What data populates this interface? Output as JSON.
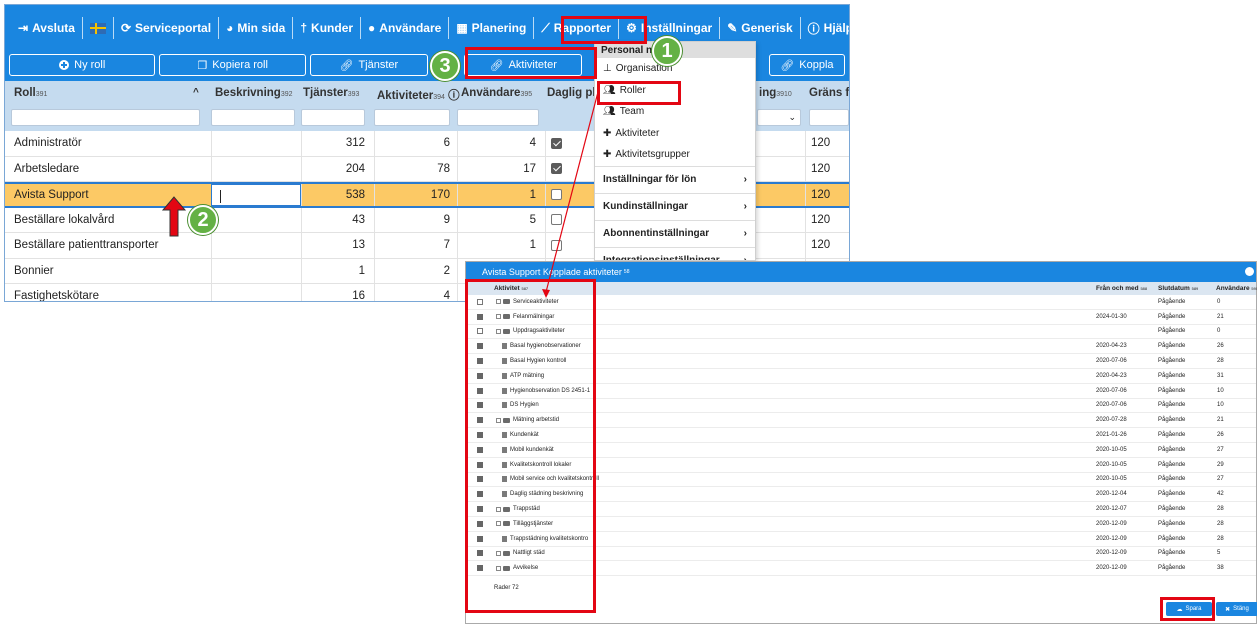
{
  "nav": {
    "items": [
      {
        "icon": "logout-icon",
        "glyph": "⇥",
        "label": "Avsluta"
      },
      {
        "icon": "swedish-flag-icon",
        "glyph": "",
        "label": ""
      },
      {
        "icon": "sync-icon",
        "glyph": "⟳",
        "label": "Serviceportal"
      },
      {
        "icon": "dashboard-icon",
        "glyph": "◕",
        "label": "Min sida"
      },
      {
        "icon": "user-tie-icon",
        "glyph": "†",
        "label": "Kunder"
      },
      {
        "icon": "user-icon",
        "glyph": "●",
        "label": "Användare"
      },
      {
        "icon": "calendar-icon",
        "glyph": "▦",
        "label": "Planering"
      },
      {
        "icon": "line-chart-icon",
        "glyph": "⟋",
        "label": "Rapporter"
      },
      {
        "icon": "cogs-icon",
        "glyph": "⚙",
        "label": "Inställningar"
      },
      {
        "icon": "wrench-icon",
        "glyph": "✎",
        "label": "Generisk"
      },
      {
        "icon": "info-icon",
        "glyph": "ⓘ",
        "label": "Hjälp/Support"
      }
    ]
  },
  "toolbar": {
    "new_role": "Ny roll",
    "copy_role": "Kopiera roll",
    "services": "Tjänster",
    "activities": "Aktiviteter",
    "linked": "Koppla"
  },
  "grid": {
    "headers": {
      "role": "Roll",
      "role_id": "391",
      "description": "Beskrivning",
      "description_id": "392",
      "services": "Tjänster",
      "services_id": "393",
      "activities": "Aktiviteter",
      "activities_id": "394",
      "users": "Användare",
      "users_id": "395",
      "daily": "Daglig pla",
      "hidden_col": "ing",
      "hidden_col_id": "3910",
      "limit": "Gräns fö"
    },
    "rows": [
      {
        "role": "Administratör",
        "services": "312",
        "activities": "6",
        "users": "4",
        "daily": true,
        "limit": "120"
      },
      {
        "role": "Arbetsledare",
        "services": "204",
        "activities": "78",
        "users": "17",
        "daily": true,
        "limit": "120"
      },
      {
        "role": "Avista Support",
        "services": "538",
        "activities": "170",
        "users": "1",
        "daily": false,
        "limit": "120"
      },
      {
        "role": "Beställare lokalvård",
        "services": "43",
        "activities": "9",
        "users": "5",
        "daily": false,
        "limit": "120"
      },
      {
        "role": "Beställare patienttransporter",
        "services": "13",
        "activities": "7",
        "users": "1",
        "daily": false,
        "limit": "120"
      },
      {
        "role": "Bonnier",
        "services": "1",
        "activities": "2",
        "users": "",
        "daily": null,
        "limit": ""
      },
      {
        "role": "Fastighetskötare",
        "services": "16",
        "activities": "4",
        "users": "",
        "daily": null,
        "limit": ""
      }
    ]
  },
  "menu": {
    "header": "Personal        ngar",
    "items": [
      {
        "icon": "sitemap-icon",
        "label": "Organisation"
      },
      {
        "icon": "users-icon",
        "label": "Roller"
      },
      {
        "icon": "users-icon",
        "label": "Team"
      },
      {
        "icon": "puzzle-icon",
        "label": "Aktiviteter"
      },
      {
        "icon": "puzzle-icon",
        "label": "Aktivitetsgrupper"
      }
    ],
    "submenus": [
      "Inställningar för lön",
      "Kundinställningar",
      "Abonnentinställningar",
      "Integrationsinställningar"
    ]
  },
  "dialog": {
    "title": "Avista Support Kopplade aktiviteter",
    "title_id": "58",
    "headers": {
      "activity": "Aktivitet",
      "activity_id": "587",
      "from": "Från och med",
      "from_id": "588",
      "end": "Slutdatum",
      "end_id": "589",
      "users": "Användare",
      "users_id": "590"
    },
    "rows": [
      {
        "checked": false,
        "kind": "folder",
        "label": "Serviceaktiviteter",
        "from": "",
        "end": "Pågående",
        "users": "0"
      },
      {
        "checked": true,
        "kind": "folder",
        "label": "Felanmälningar",
        "from": "2024-01-30",
        "end": "Pågående",
        "users": "21"
      },
      {
        "checked": false,
        "kind": "folder",
        "label": "Uppdragsaktiviteter",
        "from": "",
        "end": "Pågående",
        "users": "0"
      },
      {
        "checked": true,
        "kind": "file",
        "label": "Basal hygienobservationer",
        "from": "2020-04-23",
        "end": "Pågående",
        "users": "26"
      },
      {
        "checked": true,
        "kind": "file",
        "label": "Basal Hygien kontroll",
        "from": "2020-07-06",
        "end": "Pågående",
        "users": "28"
      },
      {
        "checked": true,
        "kind": "file",
        "label": "ATP mätning",
        "from": "2020-04-23",
        "end": "Pågående",
        "users": "31"
      },
      {
        "checked": true,
        "kind": "file",
        "label": "Hygienobservation DS 2451-1",
        "from": "2020-07-06",
        "end": "Pågående",
        "users": "10"
      },
      {
        "checked": true,
        "kind": "file",
        "label": "DS Hygien",
        "from": "2020-07-06",
        "end": "Pågående",
        "users": "10"
      },
      {
        "checked": true,
        "kind": "folder",
        "label": "Mätning arbetstid",
        "from": "2020-07-28",
        "end": "Pågående",
        "users": "21"
      },
      {
        "checked": true,
        "kind": "file",
        "label": "Kundenkät",
        "from": "2021-01-26",
        "end": "Pågående",
        "users": "26"
      },
      {
        "checked": true,
        "kind": "file",
        "label": "Mobil kundenkät",
        "from": "2020-10-05",
        "end": "Pågående",
        "users": "27"
      },
      {
        "checked": true,
        "kind": "file",
        "label": "Kvalitetskontroll lokaler",
        "from": "2020-10-05",
        "end": "Pågående",
        "users": "29"
      },
      {
        "checked": true,
        "kind": "file",
        "label": "Mobil service och kvalitetskontroll",
        "from": "2020-10-05",
        "end": "Pågående",
        "users": "27"
      },
      {
        "checked": true,
        "kind": "file",
        "label": "Daglig städning beskrivning",
        "from": "2020-12-04",
        "end": "Pågående",
        "users": "42"
      },
      {
        "checked": true,
        "kind": "folder",
        "label": "Trappstäd",
        "from": "2020-12-07",
        "end": "Pågående",
        "users": "28"
      },
      {
        "checked": true,
        "kind": "folder",
        "label": "Tilläggstjänster",
        "from": "2020-12-09",
        "end": "Pågående",
        "users": "28"
      },
      {
        "checked": true,
        "kind": "file",
        "label": "Trappstädning kvalitetskontro",
        "from": "2020-12-09",
        "end": "Pågående",
        "users": "28"
      },
      {
        "checked": true,
        "kind": "folder",
        "label": "Nattligt städ",
        "from": "2020-12-09",
        "end": "Pågående",
        "users": "5"
      },
      {
        "checked": true,
        "kind": "folder",
        "label": "Avvikelse",
        "from": "2020-12-09",
        "end": "Pågående",
        "users": "38"
      }
    ],
    "footer": "Rader 72",
    "save": "Spara",
    "close": "Stäng"
  },
  "annotations": {
    "step1": "1",
    "step2": "2",
    "step3": "3"
  },
  "colors": {
    "primary": "#1a86e0",
    "selected_row": "#fcc965",
    "highlight": "#e30613",
    "step": "#64b145"
  }
}
